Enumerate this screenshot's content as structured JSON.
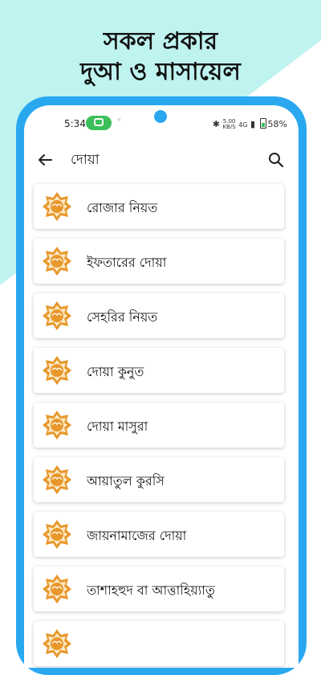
{
  "promo": {
    "line1": "সকল প্রকার",
    "line2": "দুআ ও মাসায়েল"
  },
  "status_bar": {
    "time": "5:34",
    "net_speed_top": "5.00",
    "net_speed_unit": "KB/S",
    "network": "4G",
    "battery": "58%"
  },
  "app_bar": {
    "title": "দোয়া",
    "back_icon": "arrow-left-icon",
    "search_icon": "search-icon"
  },
  "colors": {
    "phone_frame": "#29a8f0",
    "teal_bg": "#bff3f0",
    "badge_orange": "#e8972a",
    "call_green": "#3bbf5a"
  },
  "items": [
    {
      "label": "রোজার নিয়ত"
    },
    {
      "label": "ইফতারের দোয়া"
    },
    {
      "label": "সেহরির নিয়ত"
    },
    {
      "label": "দোয়া কুনুত"
    },
    {
      "label": "দোয়া মাসুরা"
    },
    {
      "label": "আয়াতুল কুরসি"
    },
    {
      "label": "জায়নামাজের দোয়া"
    },
    {
      "label": "তাশাহহুদ বা আত্তাহিয়্যাতু"
    },
    {
      "label": ""
    }
  ]
}
